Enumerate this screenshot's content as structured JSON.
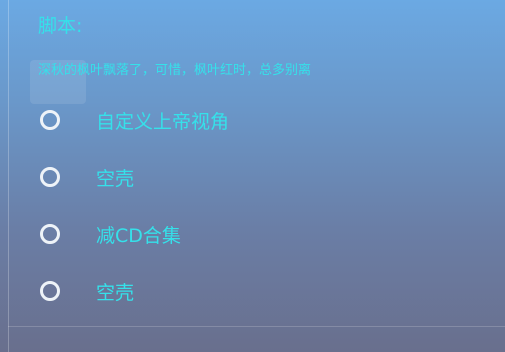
{
  "dialog": {
    "title": "脚本:",
    "subtitle": "深秋的枫叶飘落了，可惜，枫叶红时，总多别离"
  },
  "options": [
    {
      "label": "自定义上帝视角"
    },
    {
      "label": "空壳"
    },
    {
      "label": "减CD合集"
    },
    {
      "label": "空壳"
    }
  ],
  "colors": {
    "accent_text": "#35e1ea",
    "radio_ring": "#eef3f8",
    "panel_top": "#6ba9e3",
    "panel_bottom": "#696f8d"
  }
}
